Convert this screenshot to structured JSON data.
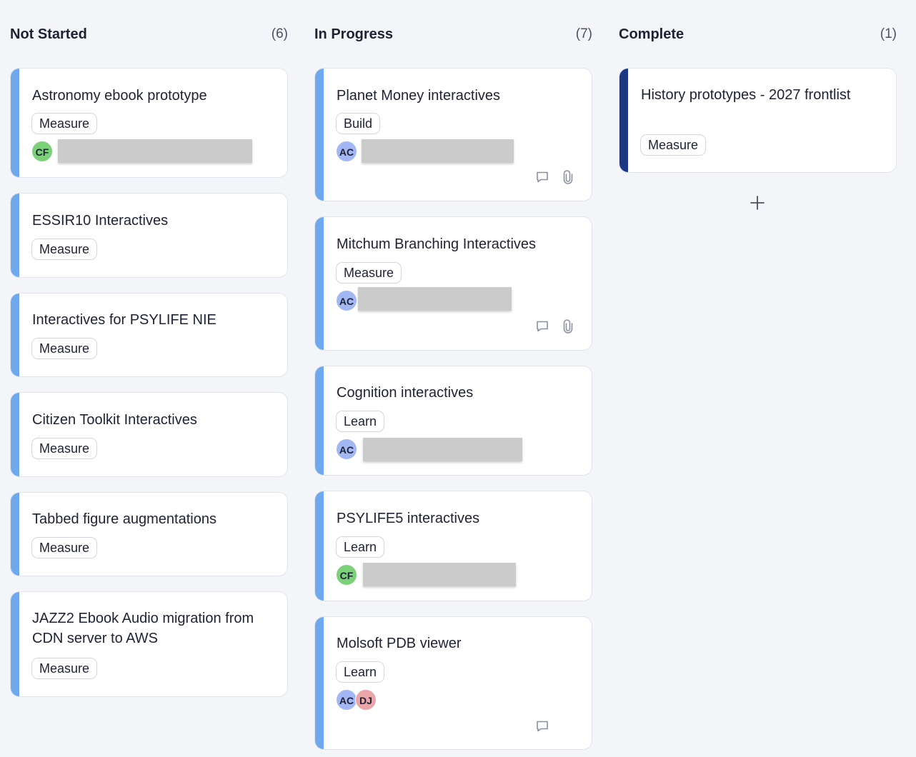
{
  "columns": [
    {
      "title": "Not Started",
      "count": "(6)",
      "cards": [
        {
          "title": "Astronomy ebook prototype",
          "tag": "Measure",
          "avatars": [
            "CF"
          ]
        },
        {
          "title": "ESSIR10 Interactives",
          "tag": "Measure"
        },
        {
          "title": "Interactives for PSYLIFE NIE",
          "tag": "Measure"
        },
        {
          "title": "Citizen Toolkit Interactives",
          "tag": "Measure"
        },
        {
          "title": "Tabbed figure augmentations",
          "tag": "Measure"
        },
        {
          "title": "JAZZ2 Ebook Audio migration from CDN server to AWS",
          "tag": "Measure"
        }
      ]
    },
    {
      "title": "In Progress",
      "count": "(7)",
      "cards": [
        {
          "title": "Planet Money interactives",
          "tag": "Build",
          "avatars": [
            "AC"
          ],
          "icons": [
            "comment-icon",
            "paperclip-icon"
          ]
        },
        {
          "title": "Mitchum Branching Interactives",
          "tag": "Measure",
          "avatars": [
            "AC"
          ],
          "icons": [
            "comment-icon",
            "paperclip-icon"
          ]
        },
        {
          "title": "Cognition interactives",
          "tag": "Learn",
          "avatars": [
            "AC"
          ]
        },
        {
          "title": "PSYLIFE5 interactives",
          "tag": "Learn",
          "avatars": [
            "CF"
          ]
        },
        {
          "title": "Molsoft PDB viewer",
          "tag": "Learn",
          "avatars": [
            "AC",
            "DJ"
          ],
          "icons": [
            "comment-icon"
          ]
        }
      ]
    },
    {
      "title": "Complete",
      "count": "(1)",
      "cards": [
        {
          "title": "History prototypes - 2027 frontlist",
          "tag": "Measure"
        }
      ]
    }
  ],
  "colors": {
    "background": "#f4f5f9",
    "card_bar_light": "#6fa8ec",
    "card_bar_dark": "#1c3783",
    "avatar_AC": "#a4b7f5",
    "avatar_CF": "#7dd07a",
    "avatar_DJ": "#eaa5a9"
  },
  "icons": {
    "comment": "comment-icon",
    "attachment": "paperclip-icon",
    "add": "plus-icon"
  }
}
